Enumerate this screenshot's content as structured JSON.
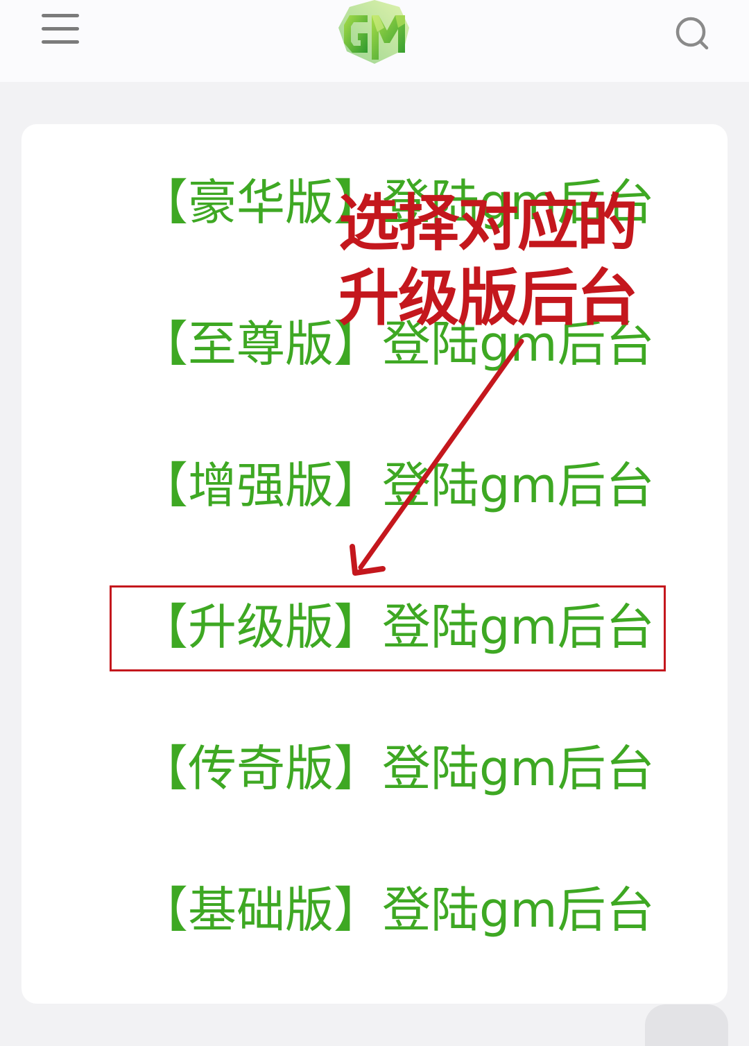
{
  "header": {
    "menu_icon": "hamburger-menu-icon",
    "logo_icon": "gm-logo",
    "search_icon": "search-icon"
  },
  "links": [
    {
      "tag": "【豪华版】",
      "label": "登陆gm后台"
    },
    {
      "tag": "【至尊版】",
      "label": "登陆gm后台"
    },
    {
      "tag": "【增强版】",
      "label": "登陆gm后台"
    },
    {
      "tag": "【升级版】",
      "label": "登陆gm后台"
    },
    {
      "tag": "【传奇版】",
      "label": "登陆gm后台"
    },
    {
      "tag": "【基础版】",
      "label": "登陆gm后台"
    }
  ],
  "annotation": {
    "line1": "选择对应的",
    "line2": "升级版后台"
  },
  "colors": {
    "link_green": "#3ea823",
    "annotation_red": "#c4171d",
    "logo_green_light": "#8bd13a",
    "logo_green_dark": "#2e9a2e"
  }
}
